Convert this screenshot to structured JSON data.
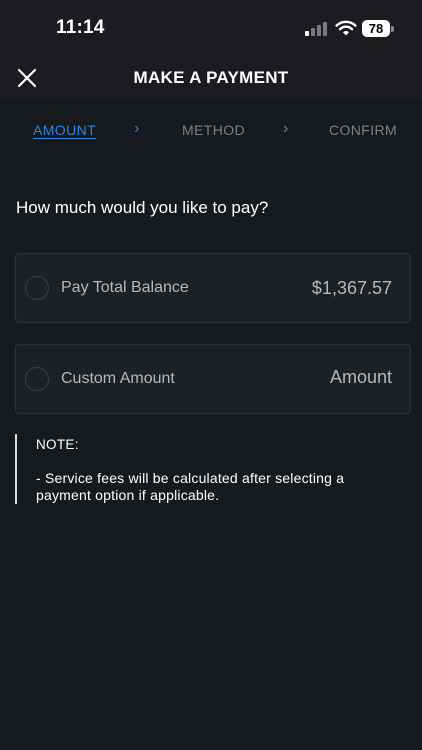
{
  "status_bar": {
    "time": "11:14",
    "battery": "78",
    "icons": [
      "cellular-signal-icon",
      "wifi-icon",
      "battery-icon"
    ]
  },
  "header": {
    "title": "MAKE A PAYMENT",
    "close_icon": "close-icon"
  },
  "stepper": {
    "steps": [
      {
        "label": "AMOUNT",
        "active": true
      },
      {
        "label": "METHOD",
        "active": false
      },
      {
        "label": "CONFIRM",
        "active": false
      }
    ],
    "separator_icon": "chevron-right-icon"
  },
  "question": "How much would you like to pay?",
  "options": [
    {
      "label": "Pay Total Balance",
      "value": "$1,367.57",
      "selected": false
    },
    {
      "label": "Custom Amount",
      "placeholder": "Amount",
      "value": "",
      "selected": false
    }
  ],
  "note": {
    "title": "NOTE:",
    "body": " - Service fees will be calculated after selecting a payment option if applicable."
  },
  "colors": {
    "background": "#16191d",
    "header_background": "#1a1c1f",
    "accent": "#2e86de",
    "inactive_step": "#7b8087",
    "card_border": "#2e3238",
    "text_primary": "#ffffff",
    "text_secondary": "#b4b8bd"
  }
}
